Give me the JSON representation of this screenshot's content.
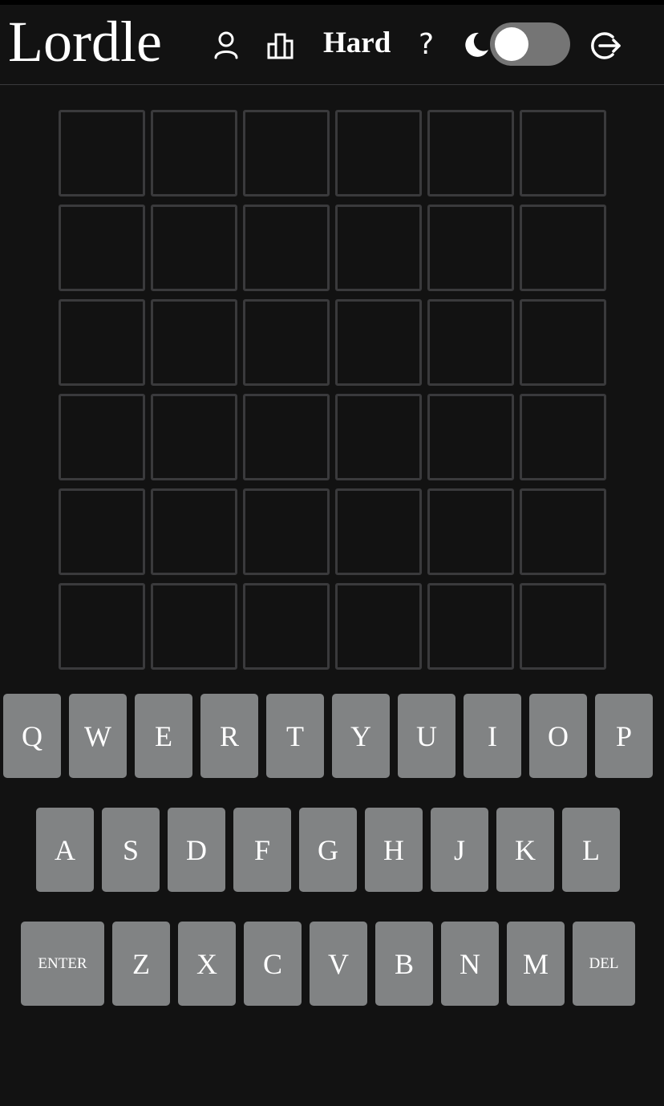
{
  "header": {
    "title": "Lordle",
    "hard_label": "Hard",
    "help_label": "?",
    "icons": [
      "user-icon",
      "stats-icon",
      "moon-icon",
      "logout-icon"
    ],
    "dark_mode_on": true
  },
  "board": {
    "rows": [
      [
        "",
        "",
        "",
        "",
        "",
        ""
      ],
      [
        "",
        "",
        "",
        "",
        "",
        ""
      ],
      [
        "",
        "",
        "",
        "",
        "",
        ""
      ],
      [
        "",
        "",
        "",
        "",
        "",
        ""
      ],
      [
        "",
        "",
        "",
        "",
        "",
        ""
      ],
      [
        "",
        "",
        "",
        "",
        "",
        ""
      ]
    ]
  },
  "keyboard": {
    "row1": [
      "Q",
      "W",
      "E",
      "R",
      "T",
      "Y",
      "U",
      "I",
      "O",
      "P"
    ],
    "row2": [
      "A",
      "S",
      "D",
      "F",
      "G",
      "H",
      "J",
      "K",
      "L"
    ],
    "row3": [
      "ENTER",
      "Z",
      "X",
      "C",
      "V",
      "B",
      "N",
      "M",
      "DEL"
    ]
  },
  "colors": {
    "background": "#121212",
    "tile_border": "#3a3a3c",
    "key": "#818384",
    "toggle_track": "#757575"
  }
}
